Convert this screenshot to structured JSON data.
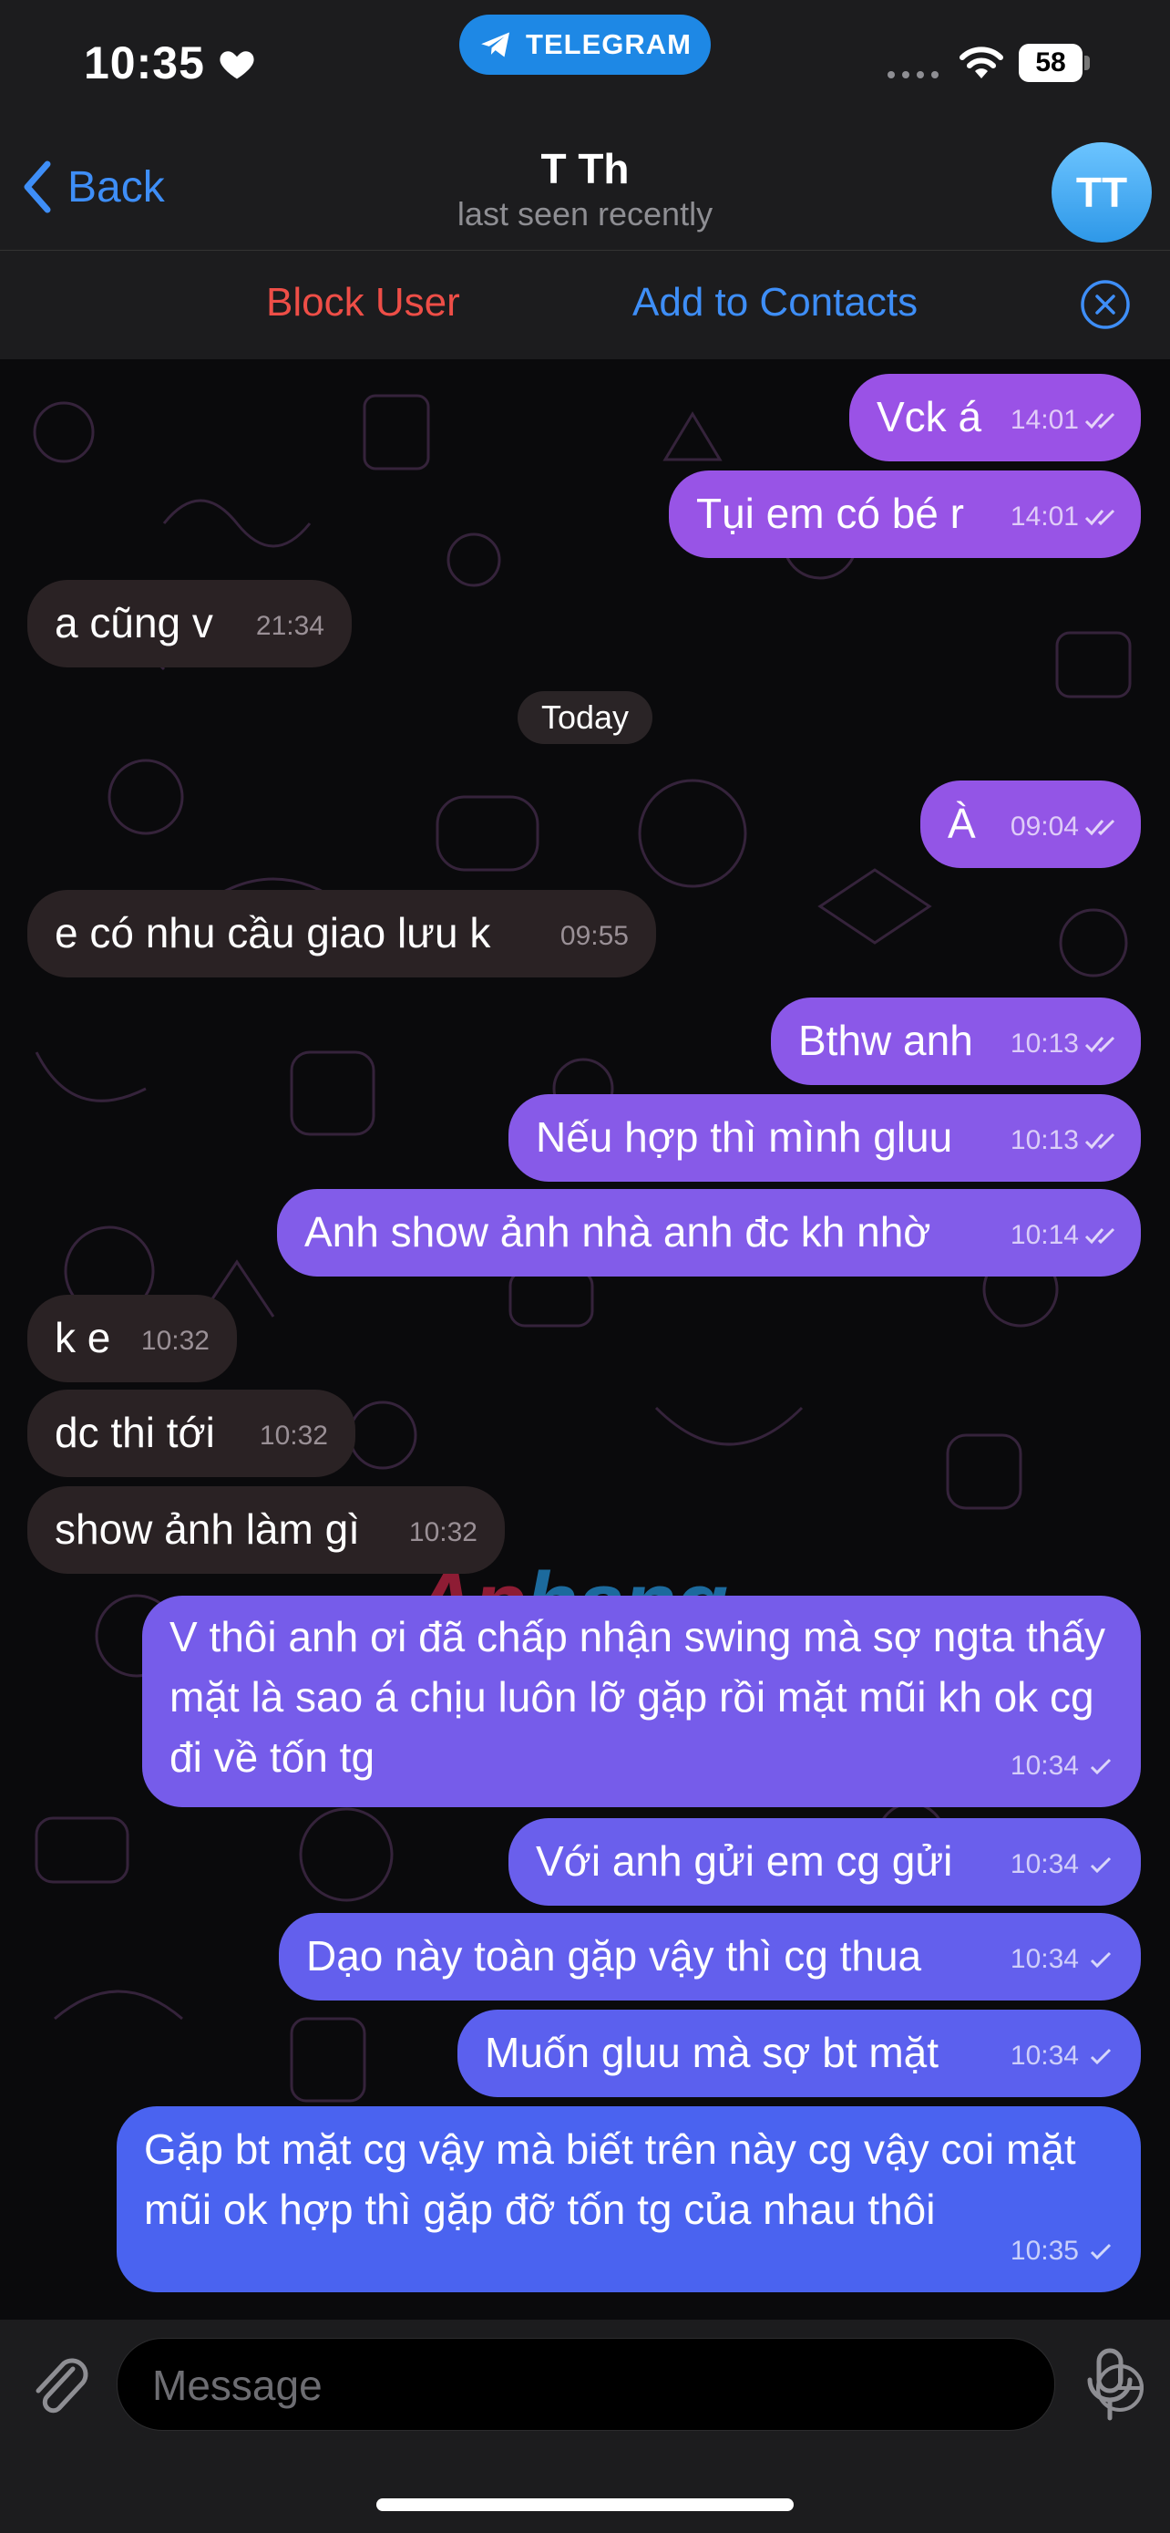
{
  "status": {
    "time": "10:35",
    "app_pill": "TELEGRAM",
    "battery": "58"
  },
  "nav": {
    "back_label": "Back",
    "title": "T Th",
    "subtitle": "last seen recently",
    "avatar_initials": "TT"
  },
  "actions": {
    "block_label": "Block User",
    "add_label": "Add to Contacts"
  },
  "messages": [
    {
      "dir": "out",
      "text": "Vck á",
      "time": "14:01",
      "read": true
    },
    {
      "dir": "out",
      "text": "Tụi em có bé r",
      "time": "14:01",
      "read": true
    },
    {
      "dir": "in",
      "text": "a cũng v",
      "time": "21:34"
    },
    {
      "dir": "out",
      "text": "À",
      "time": "09:04",
      "read": true
    },
    {
      "dir": "in",
      "text": "e có nhu cầu giao lưu k",
      "time": "09:55"
    },
    {
      "dir": "out",
      "text": "Bthw anh",
      "time": "10:13",
      "read": true
    },
    {
      "dir": "out",
      "text": "Nếu hợp thì mình gluu",
      "time": "10:13",
      "read": true
    },
    {
      "dir": "out",
      "text": "Anh show ảnh nhà anh đc kh nhờ",
      "time": "10:14",
      "read": true
    },
    {
      "dir": "in",
      "text": "k e",
      "time": "10:32"
    },
    {
      "dir": "in",
      "text": "dc thi tới",
      "time": "10:32"
    },
    {
      "dir": "in",
      "text": "show ảnh làm gì",
      "time": "10:32"
    },
    {
      "dir": "out",
      "text": "V thôi anh ơi đã chấp nhận swing mà sợ ngta thấy mặt là sao á chịu luôn lỡ gặp rồi mặt mũi kh ok cg đi về tốn tg",
      "time": "10:34",
      "read": false
    },
    {
      "dir": "out",
      "text": "Với anh gửi em cg gửi",
      "time": "10:34",
      "read": false
    },
    {
      "dir": "out",
      "text": "Dạo này toàn gặp vậy thì cg thua",
      "time": "10:34",
      "read": false
    },
    {
      "dir": "out",
      "text": "Muốn gluu mà sợ bt mặt",
      "time": "10:34",
      "read": false
    },
    {
      "dir": "out",
      "text": "Gặp bt mặt cg vậy mà biết trên này cg vậy coi mặt mũi ok hợp thì gặp đỡ tốn tg của nhau thôi",
      "time": "10:35",
      "read": false
    }
  ],
  "date_separator": "Today",
  "watermark": {
    "part1": "Ap",
    "part2": "hang"
  },
  "input": {
    "placeholder": "Message"
  },
  "colors": {
    "accent": "#3e8ef7",
    "danger": "#ee4e47",
    "incoming": "#2a2224",
    "outgoing_top": "#9a52e6",
    "outgoing_bottom": "#4a63f0"
  }
}
